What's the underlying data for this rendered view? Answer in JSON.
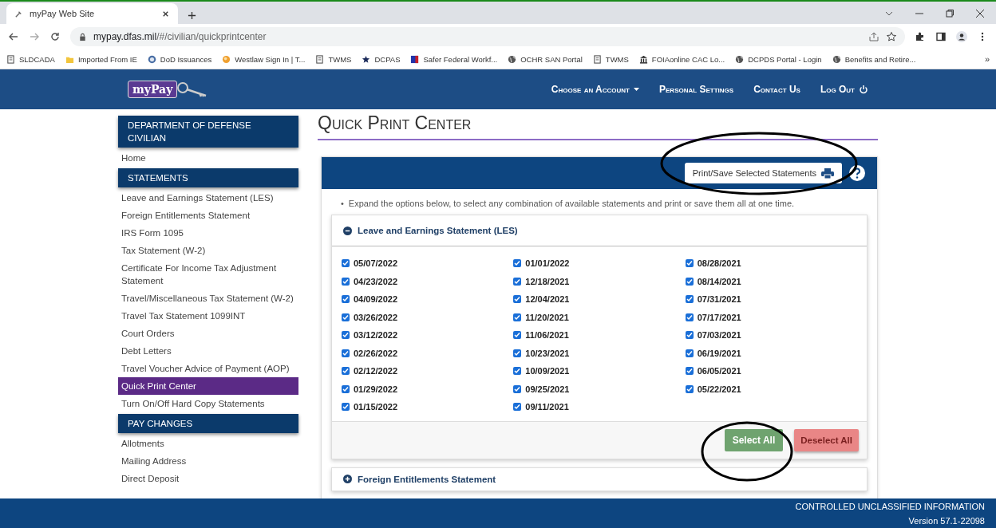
{
  "browser": {
    "tab_title": "myPay Web Site",
    "url_host": "mypay.dfas.mil",
    "url_path": "/#/civilian/quickprintcenter",
    "bookmarks": [
      {
        "label": "SLDCADA",
        "kind": "page"
      },
      {
        "label": "Imported From IE",
        "kind": "folder"
      },
      {
        "label": "DoD Issuances",
        "kind": "seal"
      },
      {
        "label": "Westlaw Sign In | T...",
        "kind": "orb"
      },
      {
        "label": "TWMS",
        "kind": "page"
      },
      {
        "label": "DCPAS",
        "kind": "star"
      },
      {
        "label": "Safer Federal Workf...",
        "kind": "flag"
      },
      {
        "label": "OCHR SAN Portal",
        "kind": "globe"
      },
      {
        "label": "TWMS",
        "kind": "page"
      },
      {
        "label": "FOIAonline CAC Lo...",
        "kind": "building"
      },
      {
        "label": "DCPDS Portal - Login",
        "kind": "globe"
      },
      {
        "label": "Benefits and Retire...",
        "kind": "globe"
      }
    ],
    "more": "»"
  },
  "site": {
    "logo": "myPay",
    "nav": [
      {
        "label": "Choose an Account",
        "kind": "dropdown"
      },
      {
        "label": "Personal Settings",
        "kind": "plain"
      },
      {
        "label": "Contact Us",
        "kind": "plain"
      },
      {
        "label": "Log Out",
        "kind": "logout"
      }
    ]
  },
  "sidebar": [
    {
      "kind": "heading",
      "label": "DEPARTMENT OF DEFENSE CIVILIAN"
    },
    {
      "kind": "link",
      "label": "Home",
      "selected": false
    },
    {
      "kind": "heading",
      "label": "STATEMENTS"
    },
    {
      "kind": "link",
      "label": "Leave and Earnings Statement (LES)",
      "selected": false
    },
    {
      "kind": "link",
      "label": "Foreign Entitlements Statement",
      "selected": false
    },
    {
      "kind": "link",
      "label": "IRS Form 1095",
      "selected": false
    },
    {
      "kind": "link",
      "label": "Tax Statement (W-2)",
      "selected": false
    },
    {
      "kind": "link",
      "label": "Certificate For Income Tax Adjustment Statement",
      "selected": false
    },
    {
      "kind": "link",
      "label": "Travel/Miscellaneous Tax Statement (W-2)",
      "selected": false
    },
    {
      "kind": "link",
      "label": "Travel Tax Statement 1099INT",
      "selected": false
    },
    {
      "kind": "link",
      "label": "Court Orders",
      "selected": false
    },
    {
      "kind": "link",
      "label": "Debt Letters",
      "selected": false
    },
    {
      "kind": "link",
      "label": "Travel Voucher Advice of Payment (AOP)",
      "selected": false
    },
    {
      "kind": "link",
      "label": "Quick Print Center",
      "selected": true
    },
    {
      "kind": "link",
      "label": "Turn On/Off Hard Copy Statements",
      "selected": false
    },
    {
      "kind": "heading",
      "label": "PAY CHANGES"
    },
    {
      "kind": "link",
      "label": "Allotments",
      "selected": false
    },
    {
      "kind": "link",
      "label": "Mailing Address",
      "selected": false
    },
    {
      "kind": "link",
      "label": "Direct Deposit",
      "selected": false
    }
  ],
  "page_title": "Quick Print Center",
  "panel": {
    "print_button": "Print/Save Selected Statements",
    "bullet": "•",
    "instruction": "Expand the options below, to select any combination of available statements and print or save them all at one time.",
    "sections": [
      {
        "title": "Leave and Earnings Statement (LES)",
        "expanded": true,
        "statements": [
          {
            "date": "05/07/2022",
            "checked": true
          },
          {
            "date": "04/23/2022",
            "checked": true
          },
          {
            "date": "04/09/2022",
            "checked": true
          },
          {
            "date": "03/26/2022",
            "checked": true
          },
          {
            "date": "03/12/2022",
            "checked": true
          },
          {
            "date": "02/26/2022",
            "checked": true
          },
          {
            "date": "02/12/2022",
            "checked": true
          },
          {
            "date": "01/29/2022",
            "checked": true
          },
          {
            "date": "01/15/2022",
            "checked": true
          },
          {
            "date": "01/01/2022",
            "checked": true
          },
          {
            "date": "12/18/2021",
            "checked": true
          },
          {
            "date": "12/04/2021",
            "checked": true
          },
          {
            "date": "11/20/2021",
            "checked": true
          },
          {
            "date": "11/06/2021",
            "checked": true
          },
          {
            "date": "10/23/2021",
            "checked": true
          },
          {
            "date": "10/09/2021",
            "checked": true
          },
          {
            "date": "09/25/2021",
            "checked": true
          },
          {
            "date": "09/11/2021",
            "checked": true
          },
          {
            "date": "08/28/2021",
            "checked": true
          },
          {
            "date": "08/14/2021",
            "checked": true
          },
          {
            "date": "07/31/2021",
            "checked": true
          },
          {
            "date": "07/17/2021",
            "checked": true
          },
          {
            "date": "07/03/2021",
            "checked": true
          },
          {
            "date": "06/19/2021",
            "checked": true
          },
          {
            "date": "06/05/2021",
            "checked": true
          },
          {
            "date": "05/22/2021",
            "checked": true
          }
        ],
        "select_all": "Select All",
        "deselect_all": "Deselect All"
      },
      {
        "title": "Foreign Entitlements Statement",
        "expanded": false
      }
    ]
  },
  "footer": {
    "notice": "CONTROLLED UNCLASSIFIED INFORMATION",
    "version": "Version 57.1-22098"
  }
}
